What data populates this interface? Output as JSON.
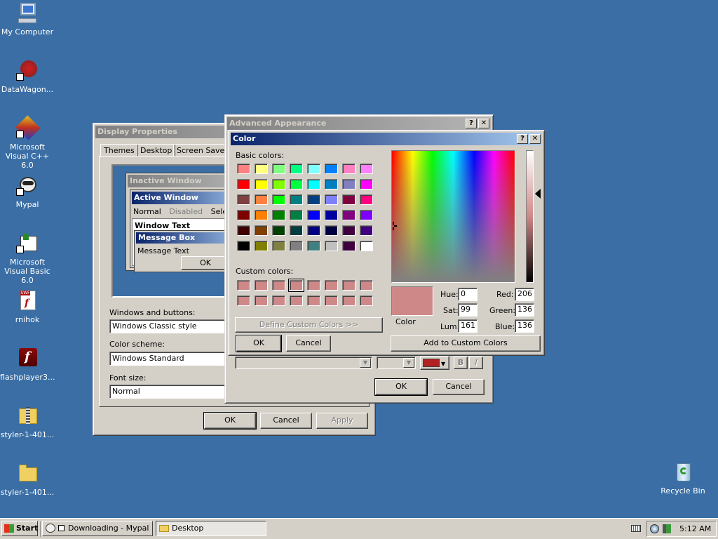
{
  "desktop": {
    "icons": [
      {
        "label": "My Computer",
        "icon": "computer-icon"
      },
      {
        "label": "DataWagon...",
        "icon": "shortcut-icon"
      },
      {
        "label": "Microsoft Visual C++ 6.0",
        "icon": "vc-icon"
      },
      {
        "label": "Mypal",
        "icon": "mypal-icon"
      },
      {
        "label": "Microsoft Visual Basic 6.0",
        "icon": "vb-icon"
      },
      {
        "label": "rnihok",
        "icon": "swf-icon"
      },
      {
        "label": "flashplayer3...",
        "icon": "flash-icon"
      },
      {
        "label": "styler-1-401...",
        "icon": "zip-folder-icon"
      },
      {
        "label": "styler-1-401...",
        "icon": "folder-icon"
      },
      {
        "label": "Recycle Bin",
        "icon": "recycle-bin-icon"
      }
    ]
  },
  "display_properties": {
    "title": "Display Properties",
    "tabs": [
      "Themes",
      "Desktop",
      "Screen Saver"
    ],
    "preview": {
      "inactive_title": "Inactive Window",
      "active_title": "Active Window",
      "menu": [
        "Normal",
        "Disabled",
        "Selecte"
      ],
      "window_text": "Window Text",
      "msgbox_title": "Message Box",
      "msgbox_text": "Message Text",
      "msgbox_ok": "OK"
    },
    "windows_buttons_label": "Windows and buttons:",
    "windows_buttons_value": "Windows Classic style",
    "color_scheme_label": "Color scheme:",
    "color_scheme_value": "Windows Standard",
    "font_size_label": "Font size:",
    "font_size_value": "Normal",
    "ok": "OK",
    "cancel": "Cancel",
    "apply": "Apply"
  },
  "advanced": {
    "title": "Advanced Appearance",
    "help": "?",
    "close": "✕",
    "bold": "B",
    "italic": "I",
    "item_color": "#b22222",
    "ok": "OK",
    "cancel": "Cancel"
  },
  "color_dialog": {
    "title": "Color",
    "help": "?",
    "close": "✕",
    "basic_label": "Basic colors:",
    "custom_label": "Custom colors:",
    "basic_colors": [
      "#ff8080",
      "#ffff80",
      "#80ff80",
      "#00ff80",
      "#80ffff",
      "#0080ff",
      "#ff80c0",
      "#ff80ff",
      "#ff0000",
      "#ffff00",
      "#80ff00",
      "#00ff40",
      "#00ffff",
      "#0080c0",
      "#8080c0",
      "#ff00ff",
      "#804040",
      "#ff8040",
      "#00ff00",
      "#008080",
      "#004080",
      "#8080ff",
      "#800040",
      "#ff0080",
      "#800000",
      "#ff8000",
      "#008000",
      "#008040",
      "#0000ff",
      "#0000a0",
      "#800080",
      "#8000ff",
      "#400000",
      "#804000",
      "#004000",
      "#004040",
      "#000080",
      "#000040",
      "#400040",
      "#400080",
      "#000000",
      "#808000",
      "#808040",
      "#808080",
      "#408080",
      "#c0c0c0",
      "#400040",
      "#ffffff"
    ],
    "custom_colors": [
      "#ce8888",
      "#ce8888",
      "#ce8888",
      "#ce8888",
      "#ce8888",
      "#ce8888",
      "#ce8888",
      "#ce8888",
      "#ce8888",
      "#ce8888",
      "#ce8888",
      "#ce8888",
      "#ce8888",
      "#ce8888",
      "#ce8888",
      "#ce8888"
    ],
    "selected_custom_index": 3,
    "define_custom": "Define Custom Colors >>",
    "ok": "OK",
    "cancel": "Cancel",
    "color_solid_label": "Color",
    "preview_color": "#ce8888",
    "hue_label": "Hue:",
    "hue": "0",
    "sat_label": "Sat:",
    "sat": "99",
    "lum_label": "Lum:",
    "lum": "161",
    "red_label": "Red:",
    "red": "206",
    "green_label": "Green:",
    "green": "136",
    "blue_label": "Blue:",
    "blue": "136",
    "add_custom": "Add to Custom Colors"
  },
  "taskbar": {
    "start": "Start",
    "items": [
      "Downloading - Mypal",
      "Desktop"
    ],
    "clock": "5:12 AM"
  }
}
